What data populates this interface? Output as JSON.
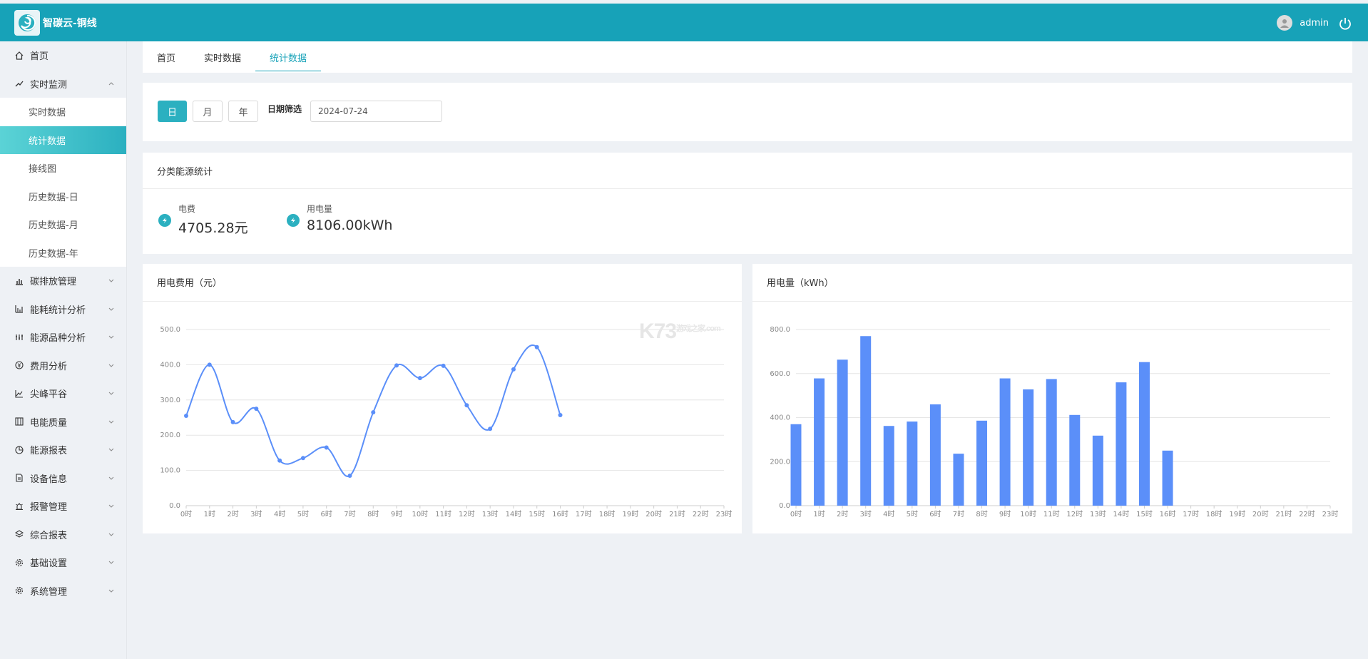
{
  "header": {
    "app_title": "智碳云-铜线",
    "user_name": "admin",
    "bg_color": "#17a2b8"
  },
  "sidebar": {
    "items": [
      {
        "label": "首页",
        "icon": "home-icon"
      },
      {
        "label": "实时监测",
        "icon": "trend-icon",
        "expanded": true
      },
      {
        "label": "碳排放管理",
        "icon": "bar-chart-icon"
      },
      {
        "label": "能耗统计分析",
        "icon": "column-chart-icon"
      },
      {
        "label": "能源品种分析",
        "icon": "sliders-icon"
      },
      {
        "label": "费用分析",
        "icon": "yen-icon"
      },
      {
        "label": "尖峰平谷",
        "icon": "line-chart-icon"
      },
      {
        "label": "电能质量",
        "icon": "grid-icon"
      },
      {
        "label": "能源报表",
        "icon": "pie-icon"
      },
      {
        "label": "设备信息",
        "icon": "document-icon"
      },
      {
        "label": "报警管理",
        "icon": "alarm-icon"
      },
      {
        "label": "综合报表",
        "icon": "layers-icon"
      },
      {
        "label": "基础设置",
        "icon": "gear-icon"
      },
      {
        "label": "系统管理",
        "icon": "gear-icon"
      }
    ],
    "sub_items": [
      "实时数据",
      "统计数据",
      "接线图",
      "历史数据-日",
      "历史数据-月",
      "历史数据-年"
    ],
    "active_sub": "统计数据"
  },
  "tabs": [
    {
      "label": "首页"
    },
    {
      "label": "实时数据"
    },
    {
      "label": "统计数据",
      "active": true
    }
  ],
  "filter": {
    "period_buttons": [
      "日",
      "月",
      "年"
    ],
    "active_period": "日",
    "date_label": "日期筛选",
    "date_value": "2024-07-24"
  },
  "stats": {
    "title": "分类能源统计",
    "items": [
      {
        "label": "电费",
        "value": "4705.28元"
      },
      {
        "label": "用电量",
        "value": "8106.00kWh"
      }
    ]
  },
  "chart_data": [
    {
      "type": "line",
      "title": "用电费用（元）",
      "categories": [
        "0时",
        "1时",
        "2时",
        "3时",
        "4时",
        "5时",
        "6时",
        "7时",
        "8时",
        "9时",
        "10时",
        "11时",
        "12时",
        "13时",
        "14时",
        "15时",
        "16时",
        "17时",
        "18时",
        "19时",
        "20时",
        "21时",
        "22时",
        "23时"
      ],
      "values": [
        255,
        400,
        237,
        275,
        128,
        135,
        165,
        85,
        265,
        398,
        362,
        397,
        285,
        218,
        387,
        450,
        257
      ],
      "ylim": [
        0,
        500
      ],
      "yticks": [
        "0.0",
        "100.0",
        "200.0",
        "300.0",
        "400.0",
        "500.0"
      ],
      "color": "#5b8ff9",
      "grid": true
    },
    {
      "type": "bar",
      "title": "用电量（kWh）",
      "categories": [
        "0时",
        "1时",
        "2时",
        "3时",
        "4时",
        "5时",
        "6时",
        "7时",
        "8时",
        "9时",
        "10时",
        "11时",
        "12时",
        "13时",
        "14时",
        "15时",
        "16时",
        "17时",
        "18时",
        "19时",
        "20时",
        "21时",
        "22时",
        "23时"
      ],
      "values": [
        370,
        578,
        663,
        770,
        362,
        382,
        460,
        236,
        386,
        578,
        528,
        575,
        412,
        318,
        560,
        652,
        250
      ],
      "ylim": [
        0,
        800
      ],
      "yticks": [
        "0.0",
        "200.0",
        "400.0",
        "600.0",
        "800.0"
      ],
      "color": "#5b8ff9",
      "grid": true
    }
  ],
  "watermark": {
    "text": "K73",
    "sub": "游戏之家.com"
  }
}
